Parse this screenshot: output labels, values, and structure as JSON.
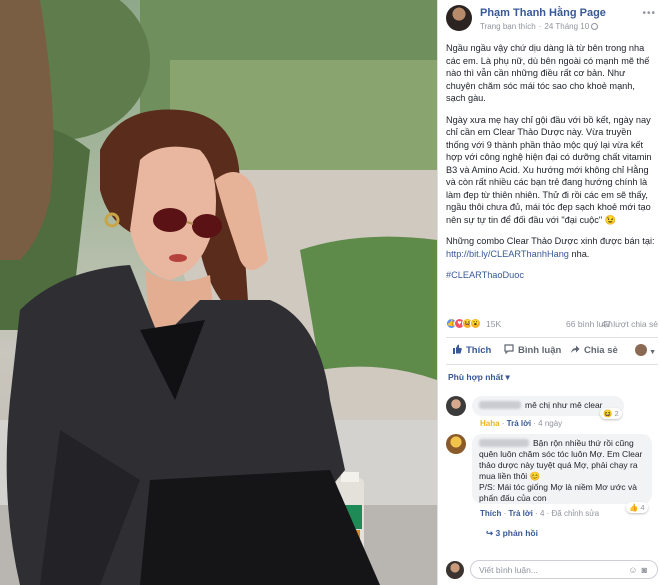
{
  "post": {
    "page_name": "Phạm Thanh Hằng Page",
    "subtitle_type": "Trang bạn thích",
    "date": "24 Tháng 10",
    "paragraphs": [
      "Ngầu ngầu vậy chứ dịu dàng là từ bên trong nha các em. Là phụ nữ, dù bên ngoài có mạnh mẽ thế nào thì vẫn cần những điều rất cơ bản. Như chuyện chăm sóc mái tóc sao cho khoẻ mạnh, sạch gàu.",
      "Ngày xưa mẹ hay chỉ gội đầu với bồ kết, ngày nay chỉ cần em Clear Thảo Dược này. Vừa truyền thống với 9 thành phần thảo mộc quý lại vừa kết hợp với công nghệ hiện đại có dưỡng chất vitamin B3 và Amino Acid. Xu hướng mới không chỉ Hằng và còn rất nhiều các bạn trẻ đang hướng chính là làm đẹp từ thiên nhiên. Thử đi rồi các em sẽ thấy, ngầu thôi chưa đủ, mái tóc đẹp sạch khoẻ mới tạo nên sự tự tin để đối đầu với \"đại cuộc\" 😉",
      "Những combo Clear Thảo Dược xinh được bán tại:"
    ],
    "link": "http://bit.ly/CLEARThanhHang",
    "link_suffix": " nha.",
    "hashtag": "#CLEARThaoDuoc"
  },
  "stats": {
    "reactions": "15K",
    "comments": "66 bình luận",
    "shares": "47 lượt chia sẻ"
  },
  "actions": {
    "like": "Thích",
    "comment": "Bình luận",
    "share": "Chia sẻ"
  },
  "sort_label": "Phù hợp nhất ▾",
  "comments": [
    {
      "text": "mê chị như mê clear",
      "meta_haha": "Haha",
      "meta_reply": "Trả lời",
      "meta_time": "4 ngày",
      "reaction_count": "2",
      "replies": ""
    },
    {
      "text": "Bận rộn nhiều thứ rồi cũng quên luôn chăm sóc tóc luôn Mợ. Em Clear thảo dược này tuyệt quá Mợ, phải chạy ra mua liền thôi 😊\nP/S: Mái tóc giống Mợ là niềm Mơ ước và phấn đấu của con",
      "meta_like": "Thích",
      "meta_reply": "Trả lời",
      "meta_time": "4",
      "meta_edited": "Đã chỉnh sửa",
      "reaction_count": "4",
      "replies": "3 phản hồi"
    }
  ],
  "write_placeholder": "Viết bình luận...",
  "colors": {
    "link": "#385898",
    "text": "#1d2129",
    "muted": "#90949c",
    "bubble": "#f2f3f5"
  }
}
